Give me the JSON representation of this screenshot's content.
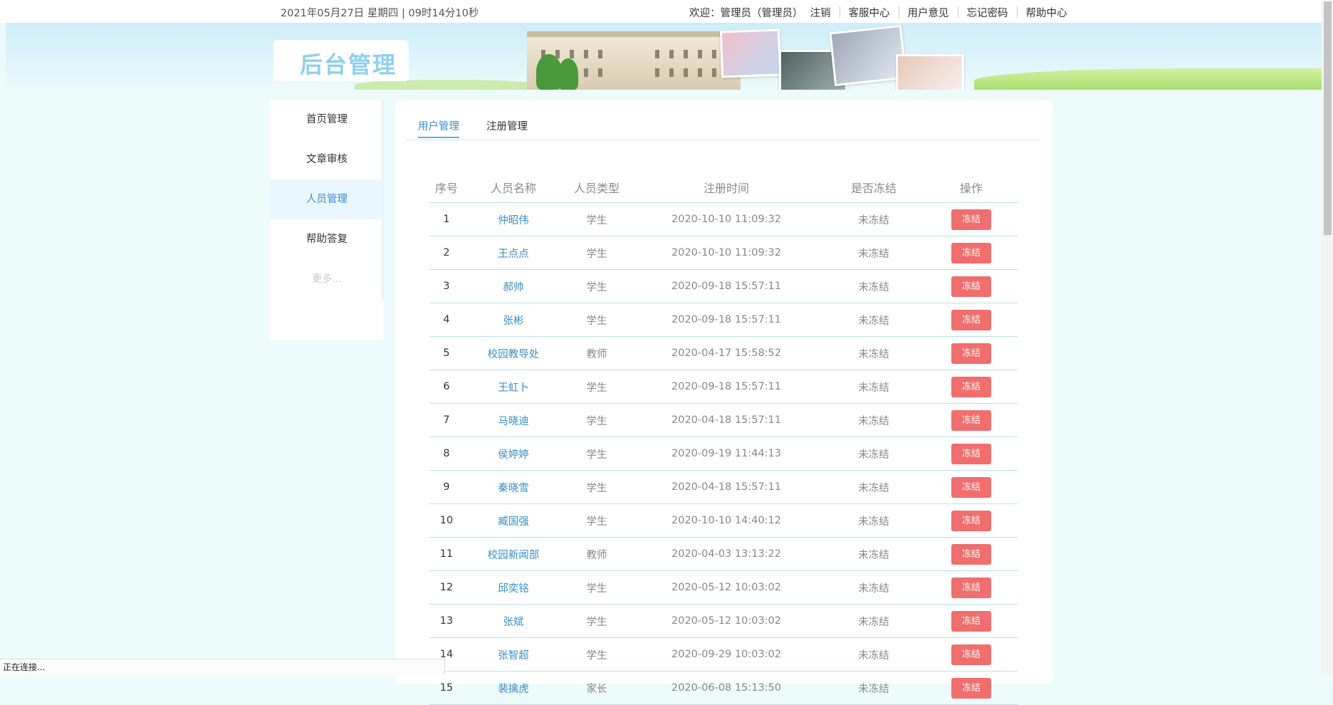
{
  "topbar": {
    "datetime": "2021年05月27日 星期四 | 09时14分10秒",
    "welcome": "欢迎：管理员（管理员）",
    "logout": "注销",
    "links": [
      "客服中心",
      "用户意见",
      "忘记密码",
      "帮助中心"
    ]
  },
  "banner": {
    "logo_text": "后台管理"
  },
  "sidebar": {
    "items": [
      "首页管理",
      "文章审核",
      "人员管理",
      "帮助答复"
    ],
    "active": "人员管理",
    "more": "更多..."
  },
  "tabs": [
    "用户管理",
    "注册管理"
  ],
  "table": {
    "headers": [
      "序号",
      "人员名称",
      "人员类型",
      "注册时间",
      "是否冻结",
      "操作"
    ],
    "action_label": "冻结",
    "rows": [
      [
        "1",
        "仲昭伟",
        "学生",
        "2020-10-10 11:09:32",
        "未冻结"
      ],
      [
        "2",
        "王点点",
        "学生",
        "2020-10-10 11:09:32",
        "未冻结"
      ],
      [
        "3",
        "郝帅",
        "学生",
        "2020-09-18 15:57:11",
        "未冻结"
      ],
      [
        "4",
        "张彬",
        "学生",
        "2020-09-18 15:57:11",
        "未冻结"
      ],
      [
        "5",
        "校园教导处",
        "教师",
        "2020-04-17 15:58:52",
        "未冻结"
      ],
      [
        "6",
        "王虹卜",
        "学生",
        "2020-09-18 15:57:11",
        "未冻结"
      ],
      [
        "7",
        "马晓迪",
        "学生",
        "2020-04-18 15:57:11",
        "未冻结"
      ],
      [
        "8",
        "侯婷婷",
        "学生",
        "2020-09-19 11:44:13",
        "未冻结"
      ],
      [
        "9",
        "秦晓雪",
        "学生",
        "2020-04-18 15:57:11",
        "未冻结"
      ],
      [
        "10",
        "臧国强",
        "学生",
        "2020-10-10 14:40:12",
        "未冻结"
      ],
      [
        "11",
        "校园新闻部",
        "教师",
        "2020-04-03 13:13:22",
        "未冻结"
      ],
      [
        "12",
        "邱奕铭",
        "学生",
        "2020-05-12 10:03:02",
        "未冻结"
      ],
      [
        "13",
        "张斌",
        "学生",
        "2020-05-12 10:03:02",
        "未冻结"
      ],
      [
        "14",
        "张智超",
        "学生",
        "2020-09-29 10:03:02",
        "未冻结"
      ],
      [
        "15",
        "裴擒虎",
        "家长",
        "2020-06-08 15:13:50",
        "未冻结"
      ]
    ]
  },
  "statusbar": {
    "text": "正在连接..."
  }
}
